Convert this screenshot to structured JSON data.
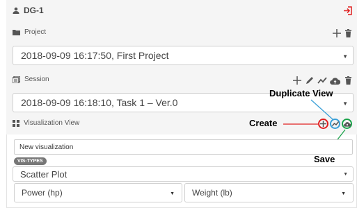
{
  "user": {
    "name": "DG-1"
  },
  "project": {
    "label": "Project",
    "selected": "2018-09-09 16:17:50, First Project"
  },
  "session": {
    "label": "Session",
    "selected": "2018-09-09 16:18:10, Task 1 – Ver.0"
  },
  "visualization": {
    "label": "Visualization View",
    "name_value": "New visualization",
    "badge": "VIS-TYPES",
    "type_selected": "Scatter Plot",
    "x_axis": "Power (hp)",
    "y_axis": "Weight (lb)"
  },
  "annotations": {
    "create": "Create",
    "duplicate_view": "Duplicate View",
    "save": "Save"
  },
  "icons": {
    "user": "user-icon",
    "logout": "logout-icon",
    "folder": "folder-icon",
    "add": "plus-icon",
    "trash": "trash-icon",
    "session": "session-icon",
    "edit": "pencil-icon",
    "chart": "line-chart-icon",
    "cloud": "cloud-upload-icon",
    "grid": "grid-icon"
  },
  "colors": {
    "create_ring": "#e02020",
    "duplicate_ring": "#3aa0d8",
    "save_ring": "#1aa34a",
    "logout": "#e02020"
  }
}
